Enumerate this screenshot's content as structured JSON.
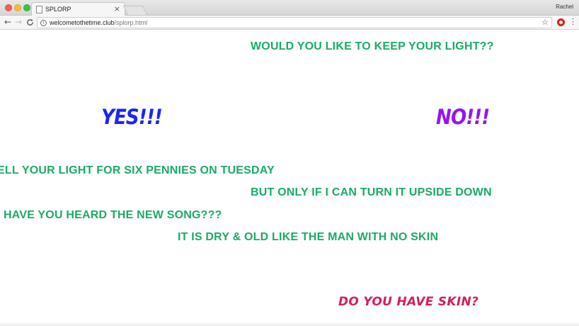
{
  "browser": {
    "tab_title": "SPLORP",
    "tab_close": "×",
    "profile_name": "Rachel",
    "url_host": "welcometothetime.club",
    "url_path": "/splorp.html",
    "back_icon": "←",
    "forward_icon": "→",
    "reload_icon": "C",
    "star_icon": "☆",
    "menu_icon": "⋮",
    "info_icon": "i"
  },
  "page": {
    "question": "WOULD YOU LIKE TO KEEP YOUR LIGHT??",
    "yes_label": "YES!!!",
    "no_label": "NO!!!",
    "line1": "ELL YOUR LIGHT FOR SIX PENNIES ON TUESDAY",
    "line2": "BUT ONLY IF I CAN TURN IT UPSIDE DOWN",
    "line3": "HAVE YOU HEARD THE NEW SONG???",
    "line4": "IT IS DRY & OLD LIKE THE MAN WITH NO SKIN",
    "skin_question": "DO YOU HAVE SKIN?"
  },
  "colors": {
    "green_text": "#1aab66",
    "yes_color": "#1a26f5",
    "no_color": "#9415f5",
    "skin_color": "#d41e5c",
    "opera_red": "#e31b23"
  }
}
